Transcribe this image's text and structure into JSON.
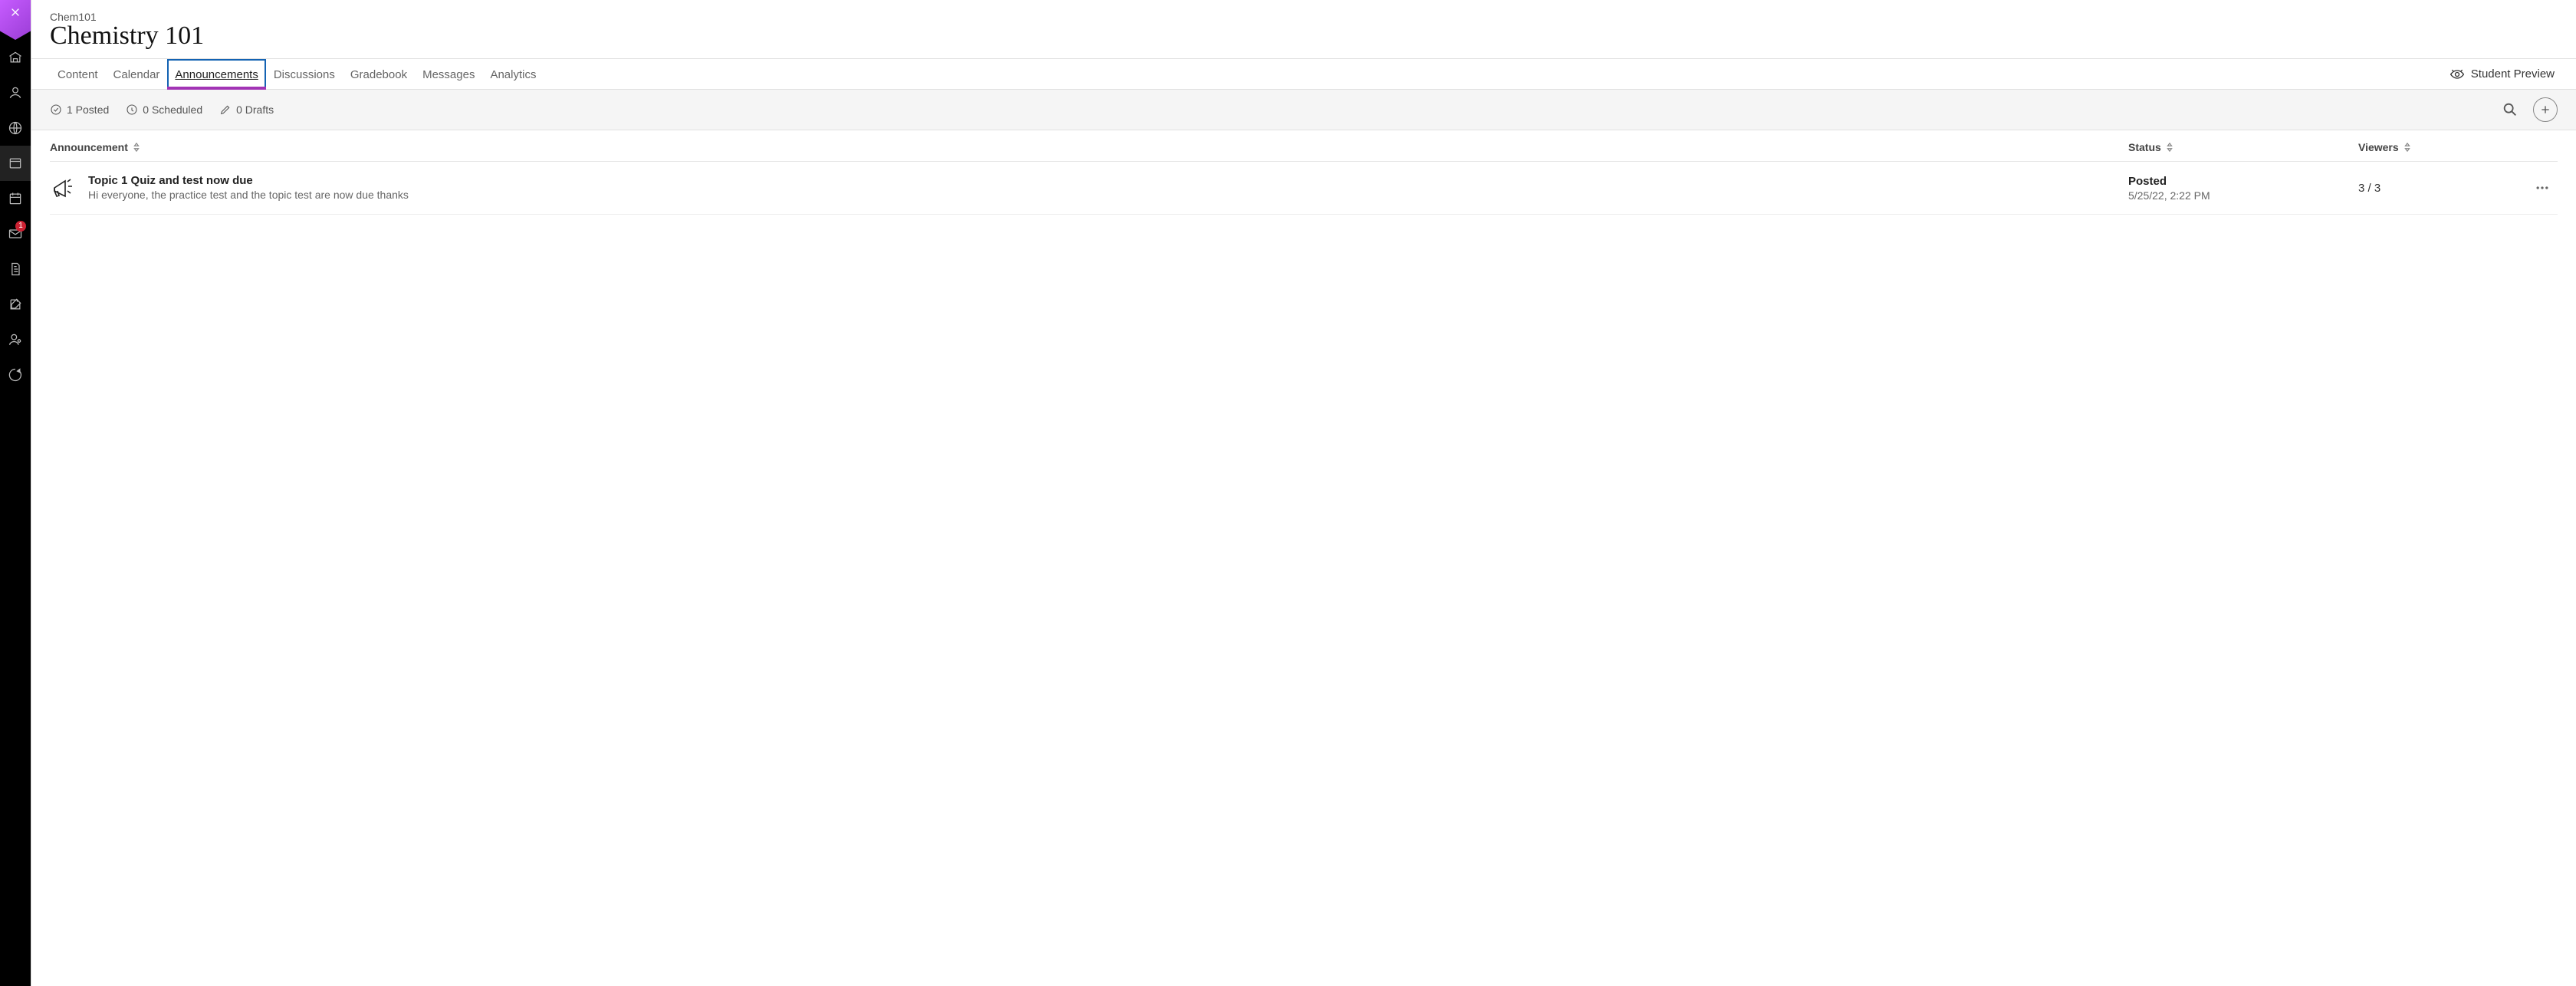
{
  "rail": {
    "messages_badge": "1"
  },
  "header": {
    "course_code": "Chem101",
    "course_title": "Chemistry 101"
  },
  "tabs": {
    "content": "Content",
    "calendar": "Calendar",
    "announcements": "Announcements",
    "discussions": "Discussions",
    "gradebook": "Gradebook",
    "messages": "Messages",
    "analytics": "Analytics"
  },
  "student_preview_label": "Student Preview",
  "filters": {
    "posted": "1 Posted",
    "scheduled": "0 Scheduled",
    "drafts": "0 Drafts"
  },
  "columns": {
    "announcement": "Announcement",
    "status": "Status",
    "viewers": "Viewers"
  },
  "rows": [
    {
      "title": "Topic 1 Quiz and test now due",
      "snippet": "Hi everyone, the practice test and the topic test are now due thanks",
      "status": "Posted",
      "date": "5/25/22, 2:22 PM",
      "viewers": "3 / 3"
    }
  ]
}
